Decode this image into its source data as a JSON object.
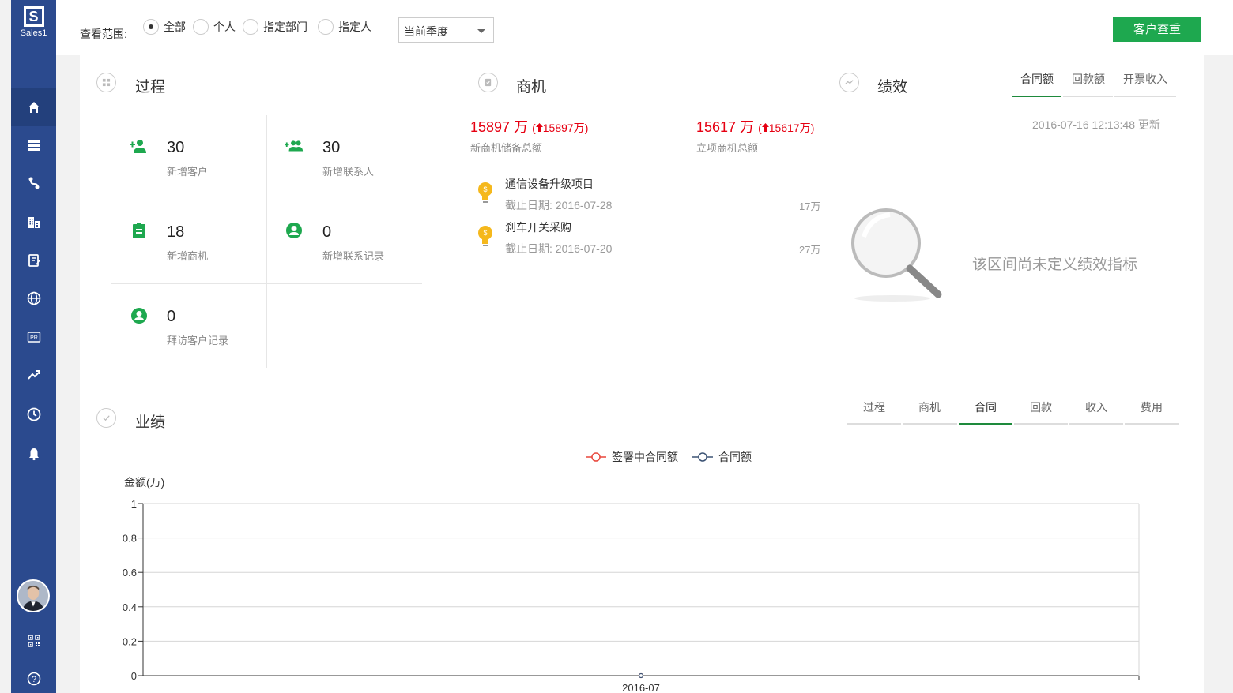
{
  "app": {
    "logo_letter": "S",
    "logo_name": "Sales1"
  },
  "sidebar": {
    "items": [
      {
        "name": "home-icon",
        "active": true
      },
      {
        "name": "grid-icon"
      },
      {
        "name": "route-icon"
      },
      {
        "name": "buildings-icon"
      },
      {
        "name": "edit-doc-icon"
      },
      {
        "name": "globe-icon"
      },
      {
        "name": "pr-icon",
        "label": "PR"
      },
      {
        "name": "trend-icon"
      },
      {
        "name": "clock-icon"
      },
      {
        "name": "bell-icon"
      }
    ],
    "bottom": [
      {
        "name": "qr-code-icon"
      },
      {
        "name": "help-icon",
        "label": "?"
      }
    ]
  },
  "filter": {
    "label": "查看范围:",
    "options": [
      "全部",
      "个人",
      "指定部门",
      "指定人"
    ],
    "selected": "全部",
    "period": "当前季度",
    "customer_check_button": "客户查重"
  },
  "process": {
    "title": "过程",
    "stats": [
      {
        "value": "30",
        "label": "新增客户",
        "icon": "add-customer-icon"
      },
      {
        "value": "30",
        "label": "新增联系人",
        "icon": "add-contacts-icon"
      },
      {
        "value": "18",
        "label": "新增商机",
        "icon": "clipboard-icon"
      },
      {
        "value": "0",
        "label": "新增联系记录",
        "icon": "person-circle-icon"
      },
      {
        "value": "0",
        "label": "拜访客户记录",
        "icon": "person-circle-icon"
      }
    ]
  },
  "opportunity": {
    "title": "商机",
    "new_total": {
      "value": "15897 万",
      "change": "15897万",
      "label": "新商机储备总额"
    },
    "project_total": {
      "value": "15617 万",
      "change": "15617万",
      "label": "立项商机总额"
    },
    "items": [
      {
        "name": "通信设备升级项目",
        "deadline": "截止日期: 2016-07-28",
        "amount": "17万"
      },
      {
        "name": "刹车开关采购",
        "deadline": "截止日期: 2016-07-20",
        "amount": "27万"
      }
    ]
  },
  "performance": {
    "title": "绩效",
    "tabs": [
      "合同额",
      "回款额",
      "开票收入"
    ],
    "active_tab": "合同额",
    "updated": "2016-07-16 12:13:48 更新",
    "empty_message": "该区间尚未定义绩效指标"
  },
  "results": {
    "title": "业绩",
    "tabs": [
      "过程",
      "商机",
      "合同",
      "回款",
      "收入",
      "费用"
    ],
    "active_tab": "合同"
  },
  "chart_data": {
    "type": "line",
    "ylabel": "金额(万)",
    "ylim": [
      0,
      1
    ],
    "yticks": [
      "1",
      "0.8",
      "0.6",
      "0.4",
      "0.2",
      "0"
    ],
    "x": [
      "2016-07"
    ],
    "legend_position": "top-center",
    "grid": true,
    "series": [
      {
        "name": "签署中合同额",
        "values": [
          0
        ],
        "color": "#e8473c"
      },
      {
        "name": "合同额",
        "values": [
          0
        ],
        "color": "#3d5475"
      }
    ]
  },
  "colors": {
    "sidebar": "#2b4a8e",
    "accent_green": "#1ea84f",
    "stat_green": "#1ea84f",
    "opp_red": "#e60012",
    "bulb": "#f5b81c"
  }
}
